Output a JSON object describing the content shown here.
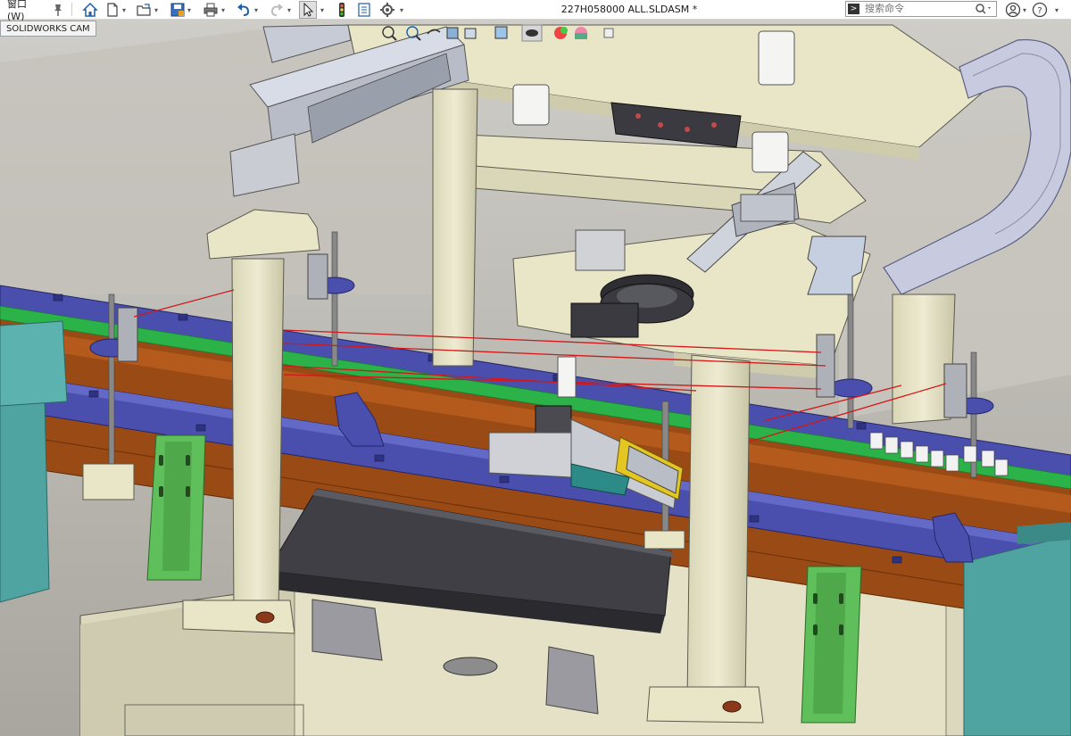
{
  "titlebar": {
    "window_menu": "窗口(W)",
    "document_title": "227H058000 ALL.SLDASM *",
    "search_placeholder": "搜索命令"
  },
  "tabs": {
    "cam_tab": "SOLIDWORKS CAM"
  },
  "icons": {
    "pin": "pin-icon",
    "home": "home-icon",
    "new": "new-document-icon",
    "open": "open-folder-icon",
    "save": "save-icon",
    "print": "print-icon",
    "undo": "undo-icon",
    "redo": "redo-icon",
    "select": "select-arrow-icon",
    "rebuild": "rebuild-traffic-light-icon",
    "file_props": "file-properties-icon",
    "options": "gear-icon",
    "command": "command-prompt-icon",
    "search": "search-icon",
    "user": "user-icon",
    "help": "help-icon"
  },
  "colors": {
    "conveyor_blue": "#4a4fae",
    "belt_green": "#2bb34a",
    "frame_cream": "#e9e6c8",
    "rail_orange": "#9a4a14",
    "dark_tray": "#3f3f45",
    "mount_green": "#5fbf5a",
    "teal_panel": "#4fa3a0",
    "sensor_red": "#d21818",
    "background": "#b7b4ad"
  }
}
